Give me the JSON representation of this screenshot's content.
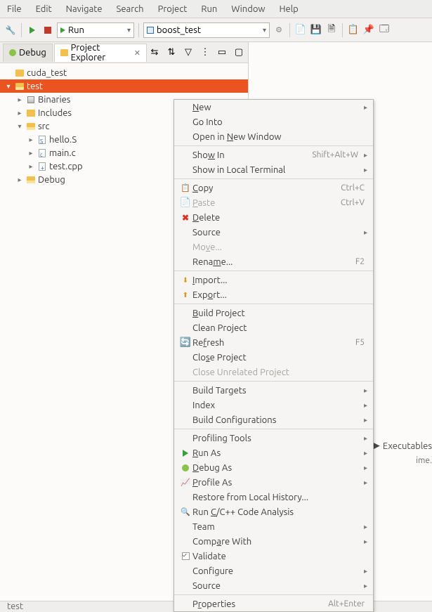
{
  "menubar": [
    "File",
    "Edit",
    "Navigate",
    "Search",
    "Project",
    "Run",
    "Window",
    "Help"
  ],
  "toolbar": {
    "run_combo": "Run",
    "config_combo": "boost_test"
  },
  "tabs": {
    "debug": "Debug",
    "explorer": "Project Explorer"
  },
  "tree": {
    "project1": "cuda_test",
    "project2": "test",
    "binaries": "Binaries",
    "includes": "Includes",
    "src": "src",
    "files": [
      "hello.S",
      "main.c",
      "test.cpp"
    ],
    "debug": "Debug"
  },
  "context_menu": {
    "new": "New",
    "go_into": "Go Into",
    "open_new_window": "Open in New Window",
    "show_in": "Show In",
    "show_in_key": "Shift+Alt+W",
    "show_local_terminal": "Show in Local Terminal",
    "copy": "Copy",
    "copy_key": "Ctrl+C",
    "paste": "Paste",
    "paste_key": "Ctrl+V",
    "delete": "Delete",
    "source": "Source",
    "move": "Move...",
    "rename": "Rename...",
    "rename_key": "F2",
    "import": "Import...",
    "export": "Export...",
    "build_project": "Build Project",
    "clean_project": "Clean Project",
    "refresh": "Refresh",
    "refresh_key": "F5",
    "close_project": "Close Project",
    "close_unrelated": "Close Unrelated Project",
    "build_targets": "Build Targets",
    "index": "Index",
    "build_configs": "Build Configurations",
    "profiling_tools": "Profiling Tools",
    "run_as": "Run As",
    "debug_as": "Debug As",
    "profile_as": "Profile As",
    "restore_local": "Restore from Local History...",
    "run_analysis": "Run C/C++ Code Analysis",
    "team": "Team",
    "compare_with": "Compare With",
    "validate": "Validate",
    "configure": "Configure",
    "source2": "Source",
    "properties": "Properties",
    "properties_key": "Alt+Enter"
  },
  "side": {
    "executables": "Executables",
    "ime": "ime."
  },
  "status": "test"
}
